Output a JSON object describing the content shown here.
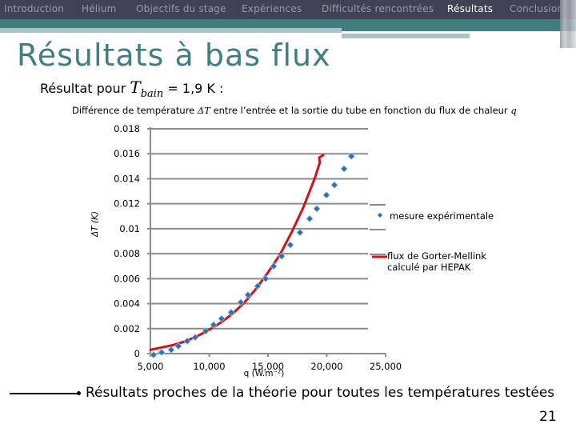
{
  "nav": {
    "items": [
      {
        "label": "Introduction",
        "active": false
      },
      {
        "label": "Hélium",
        "active": false
      },
      {
        "label": "Objectifs du stage",
        "active": false
      },
      {
        "label": "Expériences",
        "active": false
      },
      {
        "label": "Difficultés rencontrées",
        "active": false
      },
      {
        "label": "Résultats",
        "active": true
      },
      {
        "label": "Conclusion",
        "active": false
      }
    ]
  },
  "slide": {
    "title": "Résultats à bas flux",
    "subtitle_prefix": "Résultat pour",
    "subtitle_symbol": "T",
    "subtitle_symbol_sub": "bain",
    "subtitle_suffix": "= 1,9 K :",
    "conclusion": "Résultats proches de la théorie pour toutes les températures testées",
    "page_number": "21"
  },
  "colors": {
    "nav_bg": "#414055",
    "accent_teal": "#427d80",
    "series_points": "#2e6fa6",
    "series_curve": "#d0111b",
    "grid": "#8c8c8c"
  },
  "chart_data": {
    "type": "scatter",
    "title_prefix": "Différence de température",
    "title_symbol": "ΔT",
    "title_middle": "entre l’entrée et la sortie du tube en fonction du flux de chaleur",
    "title_var": "q",
    "xlabel": "q (W.m⁻²)",
    "ylabel": "ΔT (K)",
    "xlim": [
      5000,
      25000
    ],
    "ylim": [
      0,
      0.018
    ],
    "x_ticks": [
      "5,000",
      "10,000",
      "15,000",
      "20,000",
      "25,000"
    ],
    "x_tick_values": [
      5000,
      10000,
      15000,
      20000,
      25000
    ],
    "y_ticks": [
      "0",
      "0.002",
      "0.004",
      "0.006",
      "0.008",
      "0.01",
      "0.012",
      "0.014",
      "0.016",
      "0.018"
    ],
    "y_tick_values": [
      0,
      0.002,
      0.004,
      0.006,
      0.008,
      0.01,
      0.012,
      0.014,
      0.016,
      0.018
    ],
    "grid": "horizontal",
    "legend_position": "right",
    "series": [
      {
        "name": "mesure expérimentale",
        "kind": "markers",
        "points": [
          [
            5270,
            -0.0001
          ],
          [
            5950,
            0.0001
          ],
          [
            6770,
            0.0003
          ],
          [
            7380,
            0.0006
          ],
          [
            8130,
            0.001
          ],
          [
            8810,
            0.0013
          ],
          [
            9700,
            0.0018
          ],
          [
            10370,
            0.0023
          ],
          [
            11050,
            0.0028
          ],
          [
            11870,
            0.0033
          ],
          [
            12690,
            0.0041
          ],
          [
            13300,
            0.0047
          ],
          [
            14120,
            0.0054
          ],
          [
            14800,
            0.006
          ],
          [
            15480,
            0.007
          ],
          [
            16160,
            0.0078
          ],
          [
            16900,
            0.0087
          ],
          [
            17720,
            0.0097
          ],
          [
            18540,
            0.0108
          ],
          [
            19150,
            0.0116
          ],
          [
            19970,
            0.0127
          ],
          [
            20650,
            0.0135
          ],
          [
            21470,
            0.0148
          ],
          [
            22090,
            0.0158
          ]
        ]
      },
      {
        "name": "flux de Gorter-Mellink calculé par HEPAK",
        "kind": "line",
        "points": [
          [
            5000,
            0.0003
          ],
          [
            6000,
            0.0005
          ],
          [
            7000,
            0.0007
          ],
          [
            8000,
            0.001
          ],
          [
            9000,
            0.0014
          ],
          [
            10000,
            0.0019
          ],
          [
            11000,
            0.0025
          ],
          [
            12000,
            0.0032
          ],
          [
            13000,
            0.0041
          ],
          [
            14000,
            0.0052
          ],
          [
            15000,
            0.0065
          ],
          [
            16000,
            0.0079
          ],
          [
            17000,
            0.0097
          ],
          [
            18000,
            0.0117
          ],
          [
            19000,
            0.0141
          ],
          [
            19400,
            0.0153
          ],
          [
            19350,
            0.0157
          ],
          [
            19700,
            0.0159
          ]
        ]
      }
    ]
  }
}
